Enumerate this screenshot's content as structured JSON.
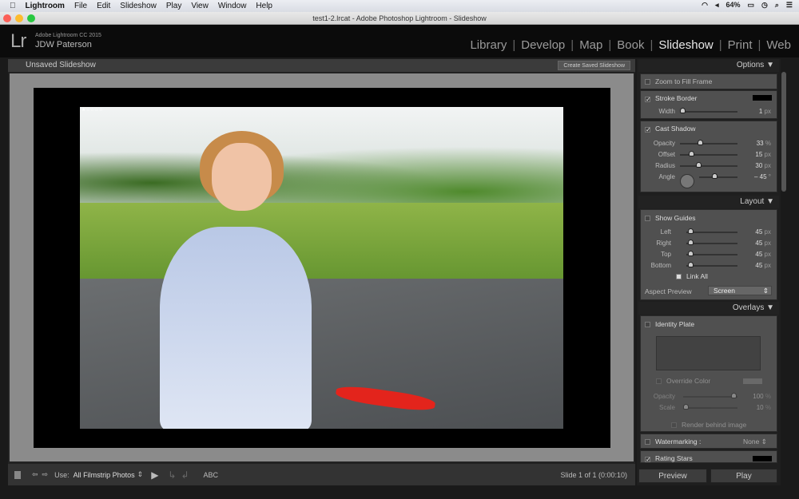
{
  "menubar": {
    "app": "Lightroom",
    "items": [
      "File",
      "Edit",
      "Slideshow",
      "Play",
      "View",
      "Window",
      "Help"
    ],
    "battery": "64%"
  },
  "window": {
    "title": "test1-2.lrcat - Adobe Photoshop Lightroom - Slideshow"
  },
  "identity": {
    "version": "Adobe Lightroom CC 2015",
    "user": "JDW Paterson",
    "logo": "Lr"
  },
  "modules": [
    {
      "label": "Library"
    },
    {
      "label": "Develop"
    },
    {
      "label": "Map"
    },
    {
      "label": "Book"
    },
    {
      "label": "Slideshow",
      "active": true
    },
    {
      "label": "Print"
    },
    {
      "label": "Web"
    }
  ],
  "slideshow": {
    "title": "Unsaved Slideshow",
    "create_saved": "Create Saved Slideshow"
  },
  "toolbar": {
    "use_label": "Use:",
    "use_value": "All Filmstrip Photos",
    "abc": "ABC",
    "status": "Slide 1 of 1 (0:00:10)"
  },
  "panels": {
    "options": {
      "title": "Options",
      "zoom_fill": "Zoom to Fill Frame",
      "zoom_fill_checked": false,
      "stroke_border": "Stroke Border",
      "stroke_checked": true,
      "stroke_color": "#000000",
      "width": {
        "label": "Width",
        "value": "1",
        "unit": "px"
      },
      "cast_shadow": "Cast Shadow",
      "shadow_checked": true,
      "opacity": {
        "label": "Opacity",
        "value": "33",
        "unit": "%"
      },
      "offset": {
        "label": "Offset",
        "value": "15",
        "unit": "px"
      },
      "radius": {
        "label": "Radius",
        "value": "30",
        "unit": "px"
      },
      "angle": {
        "label": "Angle",
        "value": "– 45",
        "unit": "°"
      }
    },
    "layout": {
      "title": "Layout",
      "show_guides": "Show Guides",
      "left": {
        "label": "Left",
        "value": "45",
        "unit": "px"
      },
      "right": {
        "label": "Right",
        "value": "45",
        "unit": "px"
      },
      "top": {
        "label": "Top",
        "value": "45",
        "unit": "px"
      },
      "bottom": {
        "label": "Bottom",
        "value": "45",
        "unit": "px"
      },
      "link_all": "Link All",
      "aspect_label": "Aspect Preview",
      "aspect_value": "Screen"
    },
    "overlays": {
      "title": "Overlays",
      "identity_plate": "Identity Plate",
      "override_color": "Override Color",
      "opacity": {
        "label": "Opacity",
        "value": "100",
        "unit": "%"
      },
      "scale": {
        "label": "Scale",
        "value": "10",
        "unit": "%"
      },
      "render_behind": "Render behind image",
      "watermarking": "Watermarking :",
      "watermark_value": "None",
      "rating_stars": "Rating Stars",
      "rating_checked": true
    }
  },
  "buttons": {
    "preview": "Preview",
    "play": "Play"
  }
}
